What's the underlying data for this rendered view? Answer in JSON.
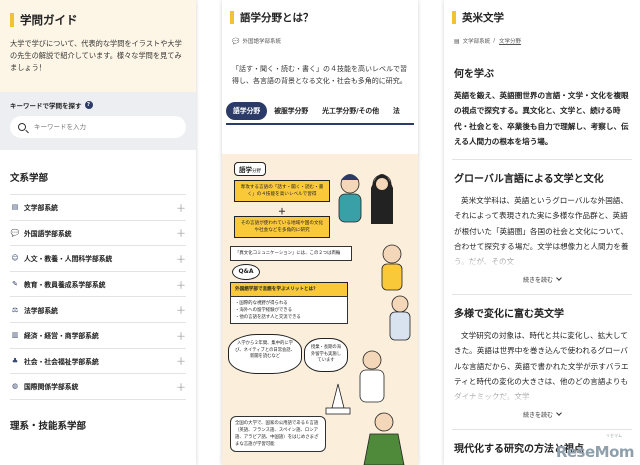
{
  "panel1": {
    "title": "学問ガイド",
    "description": "大学で学びについて、代表的な学問をイラストや大学の先生の解説で紹介しています。様々な学問を見てみましょう！",
    "search_label": "キーワードで学問を探す",
    "search_help": "?",
    "search_placeholder": "キーワードを入力",
    "section_humanities": "文系学部",
    "items": [
      {
        "icon": "book-icon",
        "glyph": "▤",
        "label": "文学部系統"
      },
      {
        "icon": "speech-icon",
        "glyph": "💬",
        "label": "外国語学部系統"
      },
      {
        "icon": "people-icon",
        "glyph": "☺",
        "label": "人文・教養・人間科学部系統"
      },
      {
        "icon": "teacher-icon",
        "glyph": "✎",
        "label": "教育・教員養成系学部系統"
      },
      {
        "icon": "law-icon",
        "glyph": "⚖",
        "label": "法学部系統"
      },
      {
        "icon": "building-icon",
        "glyph": "▥",
        "label": "経済・経営・商学部系統"
      },
      {
        "icon": "community-icon",
        "glyph": "♣",
        "label": "社会・社会福祉学部系統"
      },
      {
        "icon": "globe-icon",
        "glyph": "◍",
        "label": "国際関係学部系統"
      }
    ],
    "section_science": "理系・技能系学部"
  },
  "panel2": {
    "title": "語学分野とは？",
    "breadcrumb": "外国語学部系統",
    "description": "「話す・聞く・読む・書く」の４技能を高いレベルで習得し、各言語の背景となる文化・社会も多角的に研究。",
    "tabs": [
      "語学分野",
      "被服学分野",
      "光工学分野/その他",
      "法"
    ],
    "illus": {
      "label": "語学",
      "label_small": "分野",
      "yellow1": "専攻する言語の「話す・聞く・読む・書く」の４技能を高いレベルで習得",
      "plus": "＋",
      "yellow2": "その言語が使われている地域や国の文化や社会などを多角的に研究",
      "note": "「異文化コミュニケーション」には、この２つは両輪",
      "qa": "Q&A",
      "question": "外国語学部で言語を学ぶメリットとは？",
      "merits": "・国際的な視野が得られる\n・海外への留学経験ができる\n・他の言語を話す人と交流できる",
      "bubble1": "入学から２年間、集中的に学び、ネイティブとの日常会話、新聞を読むなど",
      "bubble2": "授業・長期の海外留学も実施しています",
      "bottom": "全国の大学で、国家の公用語である６言語（英語、フランス語、スペイン語、ロシア語、アラビア語、中国語）をはじめさまざまな言語が学習可能"
    }
  },
  "panel3": {
    "title": "英米文学",
    "breadcrumb_parent": "文学部系統",
    "breadcrumb_current": "文学分野",
    "h_why": "何を学ぶ",
    "p_why": "英語を鍛え、英語圏世界の言語・文学・文化を複眼の視点で探究する。異文化と、文学と、続ける時代・社会とを、卒業後も自力で理解し、考察し、伝える人間力の根本を培う場。",
    "h_global": "グローバル言語による文学と文化",
    "p_global": "英米文学科は、英語というグローバルな外国語、それによって表現された実に多様な作品群と、英語が根付いた「英語圏」各国の社会と文化について、合わせて探究する場だ。文学は想像力と人間力を養う。だが、その文",
    "more1": "続きを読む",
    "h_change": "多様で変化に富む英文学",
    "p_change": "文学研究の対象は、時代と共に変化し、拡大してきた。英語は世界中を巻き込んで使われるグローバルな言語だから、英語で書かれた文学が示すバラエティと時代の変化の大きさは、他のどの言語よりもダイナミックだ。文学",
    "more2": "続きを読む",
    "h_next": "現代化する研究の方法と視点"
  },
  "logo": {
    "text": "ReseMom",
    "sub": "リセマム"
  },
  "colors": {
    "accent_yellow": "#f1c232",
    "navy": "#2b3a67",
    "cream": "#fdf6e6",
    "illustration_bg": "#fbeedb"
  }
}
